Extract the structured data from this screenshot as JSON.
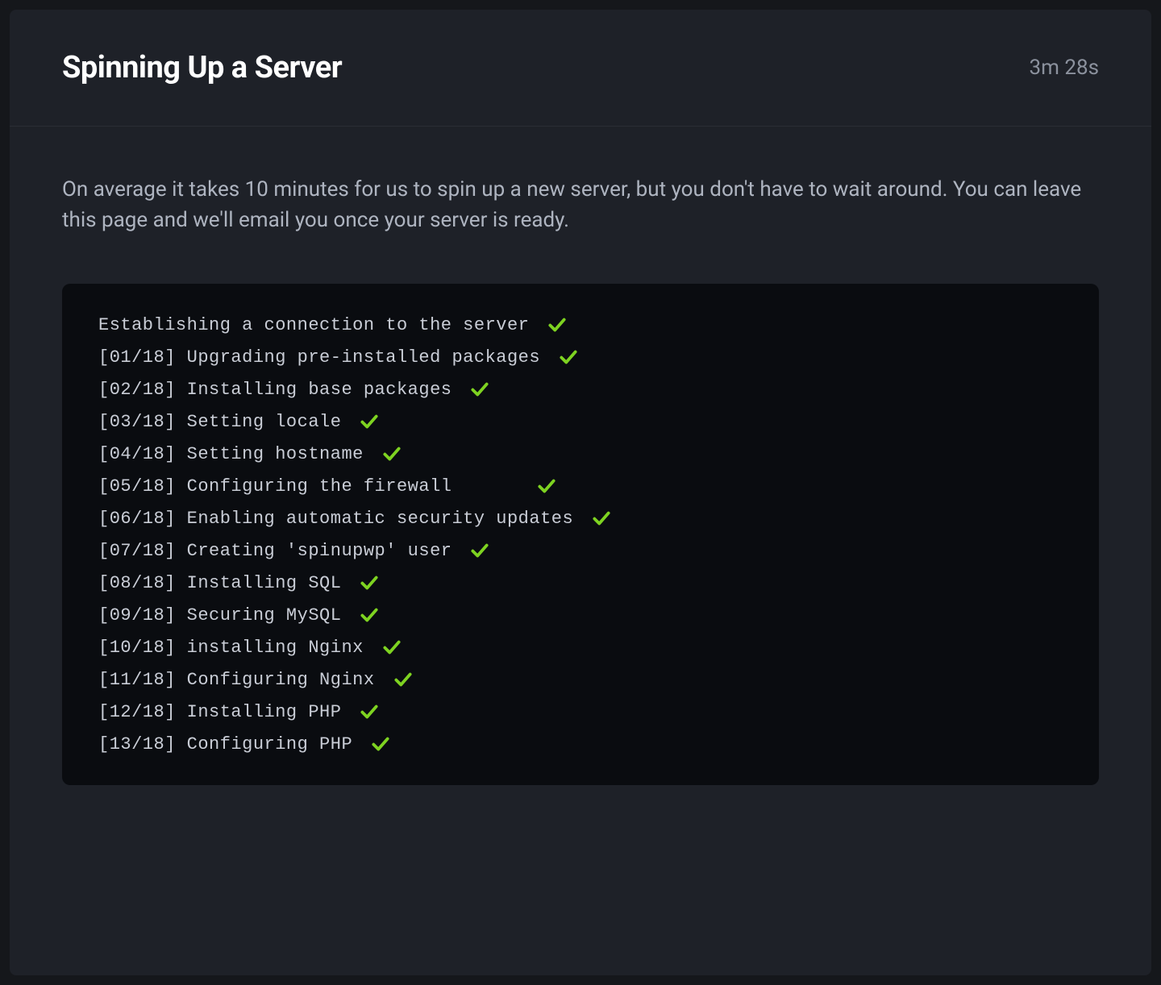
{
  "header": {
    "title": "Spinning Up a Server",
    "elapsed_time": "3m 28s"
  },
  "description": "On average it takes 10 minutes for us to spin up a new server, but you don't have to wait around. You can leave this page and we'll email you once your server is ready.",
  "log": [
    {
      "text": "Establishing a connection to the server",
      "complete": true
    },
    {
      "text": "[01/18] Upgrading pre-installed packages",
      "complete": true
    },
    {
      "text": "[02/18] Installing base packages",
      "complete": true
    },
    {
      "text": "[03/18] Setting locale",
      "complete": true
    },
    {
      "text": "[04/18] Setting hostname",
      "complete": true
    },
    {
      "text": "[05/18] Configuring the firewall      ",
      "complete": true
    },
    {
      "text": "[06/18] Enabling automatic security updates",
      "complete": true
    },
    {
      "text": "[07/18] Creating 'spinupwp' user",
      "complete": true
    },
    {
      "text": "[08/18] Installing SQL",
      "complete": true
    },
    {
      "text": "[09/18] Securing MySQL",
      "complete": true
    },
    {
      "text": "[10/18] installing Nginx",
      "complete": true
    },
    {
      "text": "[11/18] Configuring Nginx",
      "complete": true
    },
    {
      "text": "[12/18] Installing PHP",
      "complete": true
    },
    {
      "text": "[13/18] Configuring PHP",
      "complete": true
    }
  ],
  "colors": {
    "accent_green": "#7ed321",
    "bg_outer": "#15171b",
    "bg_panel": "#1e2128",
    "bg_terminal": "#0a0c10"
  }
}
